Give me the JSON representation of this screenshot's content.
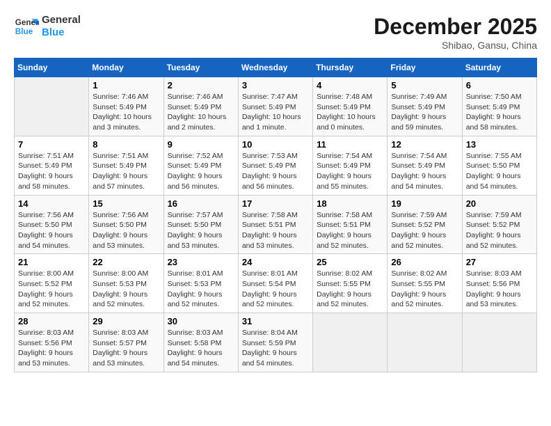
{
  "logo": {
    "line1": "General",
    "line2": "Blue"
  },
  "title": "December 2025",
  "subtitle": "Shibao, Gansu, China",
  "days_of_week": [
    "Sunday",
    "Monday",
    "Tuesday",
    "Wednesday",
    "Thursday",
    "Friday",
    "Saturday"
  ],
  "weeks": [
    [
      {
        "day": "",
        "info": ""
      },
      {
        "day": "1",
        "info": "Sunrise: 7:46 AM\nSunset: 5:49 PM\nDaylight: 10 hours\nand 3 minutes."
      },
      {
        "day": "2",
        "info": "Sunrise: 7:46 AM\nSunset: 5:49 PM\nDaylight: 10 hours\nand 2 minutes."
      },
      {
        "day": "3",
        "info": "Sunrise: 7:47 AM\nSunset: 5:49 PM\nDaylight: 10 hours\nand 1 minute."
      },
      {
        "day": "4",
        "info": "Sunrise: 7:48 AM\nSunset: 5:49 PM\nDaylight: 10 hours\nand 0 minutes."
      },
      {
        "day": "5",
        "info": "Sunrise: 7:49 AM\nSunset: 5:49 PM\nDaylight: 9 hours\nand 59 minutes."
      },
      {
        "day": "6",
        "info": "Sunrise: 7:50 AM\nSunset: 5:49 PM\nDaylight: 9 hours\nand 58 minutes."
      }
    ],
    [
      {
        "day": "7",
        "info": "Sunrise: 7:51 AM\nSunset: 5:49 PM\nDaylight: 9 hours\nand 58 minutes."
      },
      {
        "day": "8",
        "info": "Sunrise: 7:51 AM\nSunset: 5:49 PM\nDaylight: 9 hours\nand 57 minutes."
      },
      {
        "day": "9",
        "info": "Sunrise: 7:52 AM\nSunset: 5:49 PM\nDaylight: 9 hours\nand 56 minutes."
      },
      {
        "day": "10",
        "info": "Sunrise: 7:53 AM\nSunset: 5:49 PM\nDaylight: 9 hours\nand 56 minutes."
      },
      {
        "day": "11",
        "info": "Sunrise: 7:54 AM\nSunset: 5:49 PM\nDaylight: 9 hours\nand 55 minutes."
      },
      {
        "day": "12",
        "info": "Sunrise: 7:54 AM\nSunset: 5:49 PM\nDaylight: 9 hours\nand 54 minutes."
      },
      {
        "day": "13",
        "info": "Sunrise: 7:55 AM\nSunset: 5:50 PM\nDaylight: 9 hours\nand 54 minutes."
      }
    ],
    [
      {
        "day": "14",
        "info": "Sunrise: 7:56 AM\nSunset: 5:50 PM\nDaylight: 9 hours\nand 54 minutes."
      },
      {
        "day": "15",
        "info": "Sunrise: 7:56 AM\nSunset: 5:50 PM\nDaylight: 9 hours\nand 53 minutes."
      },
      {
        "day": "16",
        "info": "Sunrise: 7:57 AM\nSunset: 5:50 PM\nDaylight: 9 hours\nand 53 minutes."
      },
      {
        "day": "17",
        "info": "Sunrise: 7:58 AM\nSunset: 5:51 PM\nDaylight: 9 hours\nand 53 minutes."
      },
      {
        "day": "18",
        "info": "Sunrise: 7:58 AM\nSunset: 5:51 PM\nDaylight: 9 hours\nand 52 minutes."
      },
      {
        "day": "19",
        "info": "Sunrise: 7:59 AM\nSunset: 5:52 PM\nDaylight: 9 hours\nand 52 minutes."
      },
      {
        "day": "20",
        "info": "Sunrise: 7:59 AM\nSunset: 5:52 PM\nDaylight: 9 hours\nand 52 minutes."
      }
    ],
    [
      {
        "day": "21",
        "info": "Sunrise: 8:00 AM\nSunset: 5:52 PM\nDaylight: 9 hours\nand 52 minutes."
      },
      {
        "day": "22",
        "info": "Sunrise: 8:00 AM\nSunset: 5:53 PM\nDaylight: 9 hours\nand 52 minutes."
      },
      {
        "day": "23",
        "info": "Sunrise: 8:01 AM\nSunset: 5:53 PM\nDaylight: 9 hours\nand 52 minutes."
      },
      {
        "day": "24",
        "info": "Sunrise: 8:01 AM\nSunset: 5:54 PM\nDaylight: 9 hours\nand 52 minutes."
      },
      {
        "day": "25",
        "info": "Sunrise: 8:02 AM\nSunset: 5:55 PM\nDaylight: 9 hours\nand 52 minutes."
      },
      {
        "day": "26",
        "info": "Sunrise: 8:02 AM\nSunset: 5:55 PM\nDaylight: 9 hours\nand 52 minutes."
      },
      {
        "day": "27",
        "info": "Sunrise: 8:03 AM\nSunset: 5:56 PM\nDaylight: 9 hours\nand 53 minutes."
      }
    ],
    [
      {
        "day": "28",
        "info": "Sunrise: 8:03 AM\nSunset: 5:56 PM\nDaylight: 9 hours\nand 53 minutes."
      },
      {
        "day": "29",
        "info": "Sunrise: 8:03 AM\nSunset: 5:57 PM\nDaylight: 9 hours\nand 53 minutes."
      },
      {
        "day": "30",
        "info": "Sunrise: 8:03 AM\nSunset: 5:58 PM\nDaylight: 9 hours\nand 54 minutes."
      },
      {
        "day": "31",
        "info": "Sunrise: 8:04 AM\nSunset: 5:59 PM\nDaylight: 9 hours\nand 54 minutes."
      },
      {
        "day": "",
        "info": ""
      },
      {
        "day": "",
        "info": ""
      },
      {
        "day": "",
        "info": ""
      }
    ]
  ]
}
